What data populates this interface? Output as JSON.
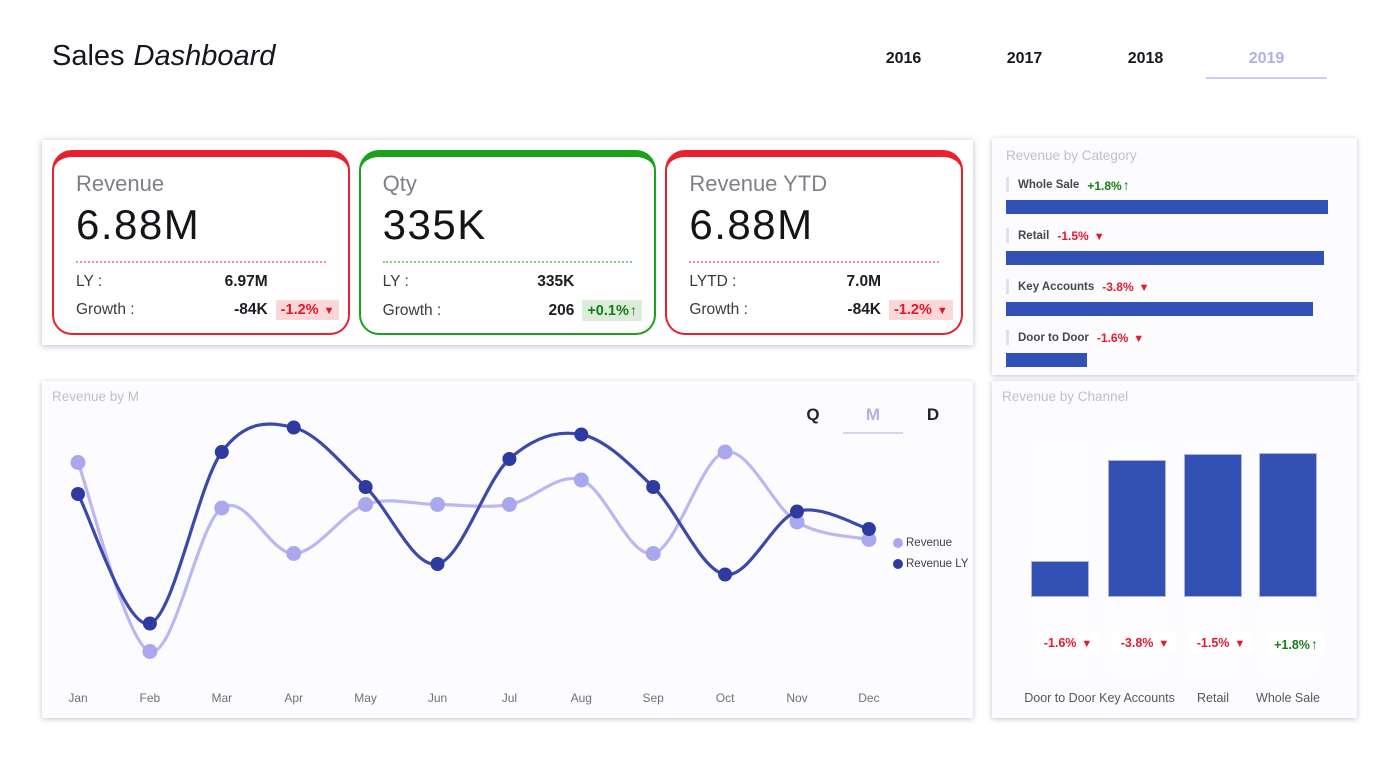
{
  "colors": {
    "accent_red": "#e8212d",
    "accent_green": "#1ba11b",
    "bar_blue": "#3350b5",
    "line_revenue": "#bbb7f3",
    "line_revenue_ly": "#3a49ab",
    "dot_revenue": "#aba7ef",
    "dot_revenue_ly": "#2e3a9f",
    "selected_tab": "#b1ade8",
    "badge_negative_text": "#e8192c",
    "badge_positive_text": "#157d15",
    "badge_negative_bg": "#fbd7d7",
    "badge_positive_bg": "#dcecdb"
  },
  "header": {
    "title_regular": "Sales",
    "title_italic": "Dashboard",
    "years": [
      {
        "label": "2016",
        "selected": false
      },
      {
        "label": "2017",
        "selected": false
      },
      {
        "label": "2018",
        "selected": false
      },
      {
        "label": "2019",
        "selected": true
      }
    ]
  },
  "kpi_cards": [
    {
      "title": "Revenue",
      "value": "6.88M",
      "accent": "red",
      "rows": [
        {
          "label": "LY :",
          "value": "6.97M"
        },
        {
          "label": "Growth :",
          "value": "-84K",
          "badge": {
            "label": "-1.2%",
            "arrow": "▼",
            "direction": "down"
          }
        }
      ]
    },
    {
      "title": "Qty",
      "value": "335K",
      "accent": "green",
      "rows": [
        {
          "label": "LY :",
          "value": "335K"
        },
        {
          "label": "Growth :",
          "value": "206",
          "badge": {
            "label": "+0.1%",
            "arrow": "↑",
            "direction": "up"
          }
        }
      ]
    },
    {
      "title": "Revenue YTD",
      "value": "6.88M",
      "accent": "red",
      "rows": [
        {
          "label": "LYTD :",
          "value": "7.0M"
        },
        {
          "label": "Growth :",
          "value": "-84K",
          "badge": {
            "label": "-1.2%",
            "arrow": "▼",
            "direction": "down"
          }
        }
      ]
    }
  ],
  "category_panel": {
    "title": "Revenue by Category"
  },
  "line_panel": {
    "title": "Revenue by M",
    "toggles": [
      {
        "label": "Q",
        "selected": false
      },
      {
        "label": "M",
        "selected": true
      },
      {
        "label": "D",
        "selected": false
      }
    ]
  },
  "channel_panel": {
    "title": "Revenue by Channel"
  },
  "chart_data": [
    {
      "type": "line",
      "title": "Revenue by M",
      "x": [
        "Jan",
        "Feb",
        "Mar",
        "Apr",
        "May",
        "Jun",
        "Jul",
        "Aug",
        "Sep",
        "Oct",
        "Nov",
        "Dec"
      ],
      "series": [
        {
          "name": "Revenue",
          "values": [
            675,
            405,
            610,
            545,
            615,
            615,
            615,
            650,
            545,
            690,
            590,
            565
          ]
        },
        {
          "name": "Revenue LY",
          "values": [
            630,
            445,
            690,
            725,
            640,
            530,
            680,
            715,
            640,
            515,
            605,
            580
          ]
        }
      ],
      "ylim": [
        350,
        750
      ],
      "y_axis_shown": false,
      "note": "No y-axis labels shown; values estimated from point positions on a relative scale.",
      "legend_position": "right",
      "grid": false
    },
    {
      "type": "bar",
      "orientation": "horizontal",
      "title": "Revenue by Category",
      "categories": [
        "Whole Sale",
        "Retail",
        "Key Accounts",
        "Door to Door"
      ],
      "values_pct_of_max": [
        100,
        98.8,
        95.4,
        25.2
      ],
      "growth": [
        {
          "label": "+1.8%",
          "arrow": "↑",
          "direction": "up"
        },
        {
          "label": "-1.5%",
          "arrow": "▼",
          "direction": "down"
        },
        {
          "label": "-3.8%",
          "arrow": "▼",
          "direction": "down"
        },
        {
          "label": "-1.6%",
          "arrow": "▼",
          "direction": "down"
        }
      ],
      "value_axis_shown": false
    },
    {
      "type": "bar",
      "orientation": "vertical",
      "title": "Revenue by Channel",
      "categories": [
        "Door to Door",
        "Key Accounts",
        "Retail",
        "Whole Sale"
      ],
      "values_pct_of_max": [
        25,
        95,
        99,
        100
      ],
      "growth": [
        {
          "label": "-1.6%",
          "arrow": "▼",
          "direction": "down"
        },
        {
          "label": "-3.8%",
          "arrow": "▼",
          "direction": "down"
        },
        {
          "label": "-1.5%",
          "arrow": "▼",
          "direction": "down"
        },
        {
          "label": "+1.8%",
          "arrow": "↑",
          "direction": "up"
        }
      ],
      "value_axis_shown": false
    }
  ]
}
